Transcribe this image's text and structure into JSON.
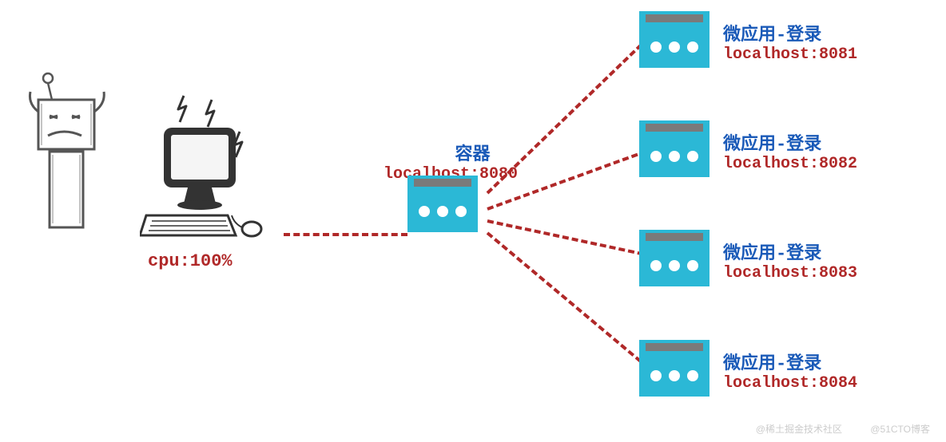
{
  "cpu_label": "cpu:100%",
  "container": {
    "title": "容器",
    "host": "localhost:8080"
  },
  "micro_apps": [
    {
      "title": "微应用-登录",
      "host": "localhost:8081"
    },
    {
      "title": "微应用-登录",
      "host": "localhost:8082"
    },
    {
      "title": "微应用-登录",
      "host": "localhost:8083"
    },
    {
      "title": "微应用-登录",
      "host": "localhost:8084"
    }
  ],
  "watermarks": {
    "w1": "@51CTO博客",
    "w2": "@稀土掘金技术社区"
  }
}
